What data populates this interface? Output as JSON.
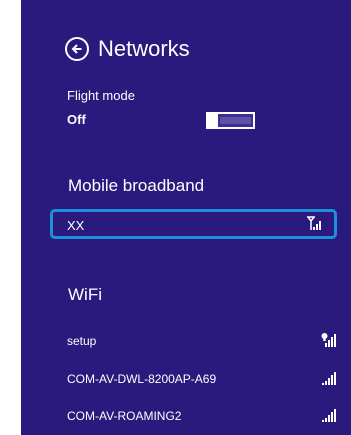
{
  "header": {
    "title": "Networks"
  },
  "flight_mode": {
    "label": "Flight mode",
    "state": "Off"
  },
  "mobile_broadband": {
    "title": "Mobile broadband",
    "items": [
      {
        "name": "XX",
        "icon": "signal-bars-antenna-icon"
      }
    ]
  },
  "wifi": {
    "title": "WiFi",
    "items": [
      {
        "name": "setup",
        "icon": "wifi-secured-signal-icon"
      },
      {
        "name": "COM-AV-DWL-8200AP-A69",
        "icon": "signal-bars-icon"
      },
      {
        "name": "COM-AV-ROAMING2",
        "icon": "signal-bars-icon"
      }
    ]
  },
  "colors": {
    "background": "#2a1a7e",
    "accent": "#1e8fd9",
    "text": "#ffffff"
  }
}
